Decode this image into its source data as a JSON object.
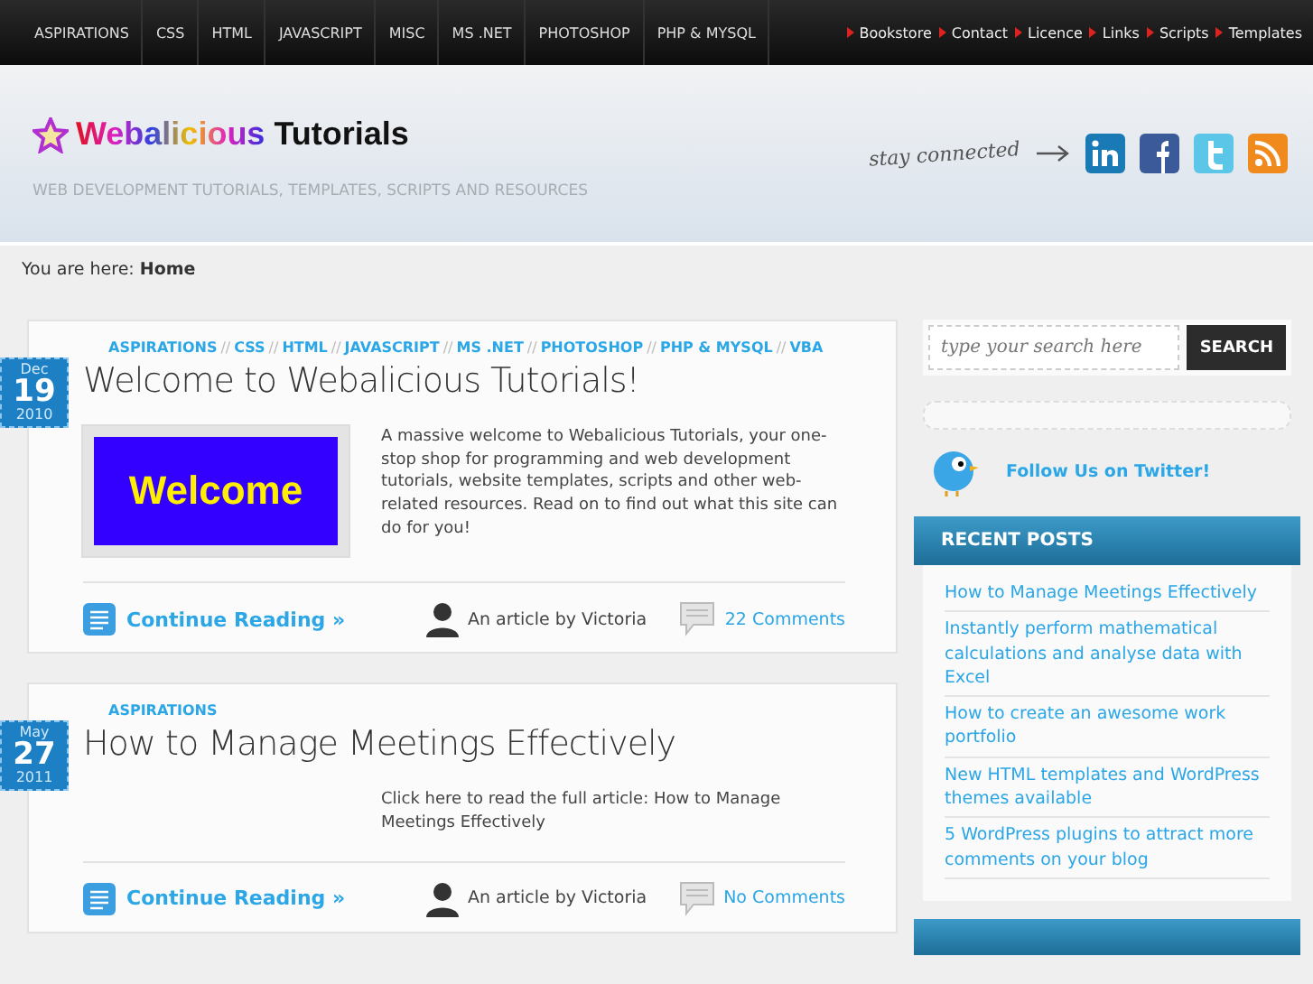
{
  "nav": {
    "categories": [
      "ASPIRATIONS",
      "CSS",
      "HTML",
      "JAVASCRIPT",
      "MISC",
      "MS .NET",
      "PHOTOSHOP",
      "PHP & MYSQL"
    ],
    "links": [
      "Bookstore",
      "Contact",
      "Licence",
      "Links",
      "Scripts",
      "Templates"
    ]
  },
  "header": {
    "logo_first": "Webalicious",
    "logo_second": "Tutorials",
    "tagline": "WEB DEVELOPMENT TUTORIALS, TEMPLATES, SCRIPTS AND RESOURCES",
    "stay_connected": "stay connected"
  },
  "breadcrumb": {
    "label": "You are here:",
    "current": "Home"
  },
  "posts": [
    {
      "month": "Dec",
      "day": "19",
      "year": "2010",
      "separator": "//",
      "tags": [
        "ASPIRATIONS",
        "CSS",
        "HTML",
        "JAVASCRIPT",
        "MS .NET",
        "PHOTOSHOP",
        "PHP & MYSQL",
        "VBA"
      ],
      "title": "Welcome to Webalicious Tutorials!",
      "thumbnail": "Welcome",
      "excerpt": "A massive welcome to Webalicious Tutorials, your one-stop shop for programming and web development tutorials, website templates, scripts and other web-related resources. Read on to find out what this site can do for you!",
      "continue": "Continue Reading »",
      "author": "An article by Victoria",
      "comments": "22 Comments"
    },
    {
      "month": "May",
      "day": "27",
      "year": "2011",
      "tags": [
        "ASPIRATIONS"
      ],
      "title": "How to Manage Meetings Effectively",
      "excerpt": "Click here to read the full article: How to Manage Meetings Effectively",
      "continue": "Continue Reading »",
      "author": "An article by Victoria",
      "comments": "No Comments"
    }
  ],
  "sidebar": {
    "search": {
      "placeholder": "type your search here",
      "button": "SEARCH"
    },
    "twitter": "Follow Us on Twitter!",
    "recent_posts": {
      "title": "RECENT POSTS",
      "items": [
        "How to Manage Meetings Effectively",
        "Instantly perform mathematical calculations and analyse data with Excel",
        "How to create an awesome work portfolio",
        "New HTML templates and WordPress themes available",
        "5 WordPress plugins to attract more comments on your blog"
      ]
    }
  }
}
